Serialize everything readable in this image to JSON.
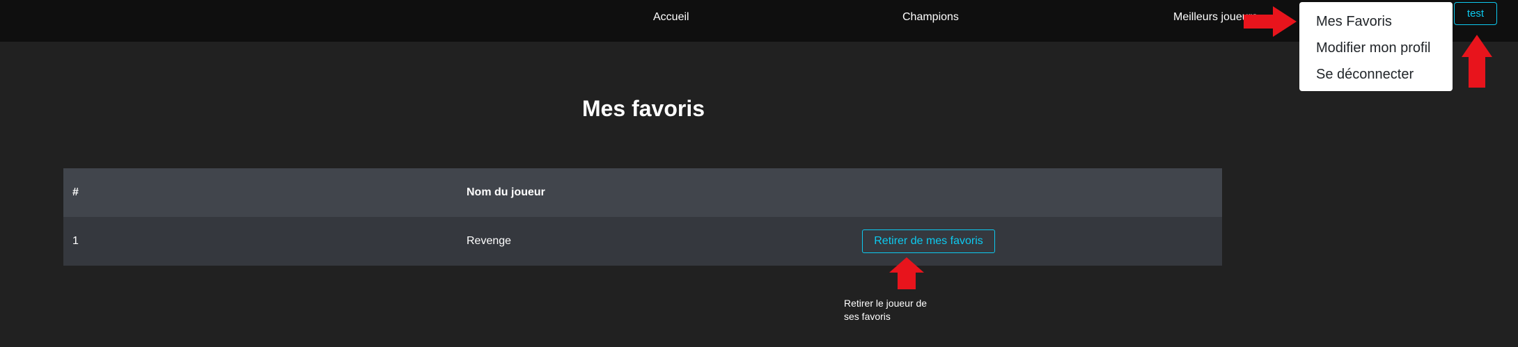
{
  "navbar": {
    "links": [
      "Accueil",
      "Champions",
      "Meilleurs joueurs"
    ],
    "user_button": "test",
    "dropdown": [
      "Mes Favoris",
      "Modifier mon profil",
      "Se déconnecter"
    ]
  },
  "page": {
    "title": "Mes favoris"
  },
  "table": {
    "headers": [
      "#",
      "Nom du joueur",
      ""
    ],
    "rows": [
      {
        "index": "1",
        "name": "Revenge",
        "action": "Retirer de mes favoris"
      }
    ]
  },
  "annotations": {
    "note": "Retirer le joueur de ses favoris",
    "arrow_color": "#e8141c"
  },
  "colors": {
    "accent": "#0dcaf0",
    "background": "#212121",
    "navbar": "#0f0f0f"
  }
}
